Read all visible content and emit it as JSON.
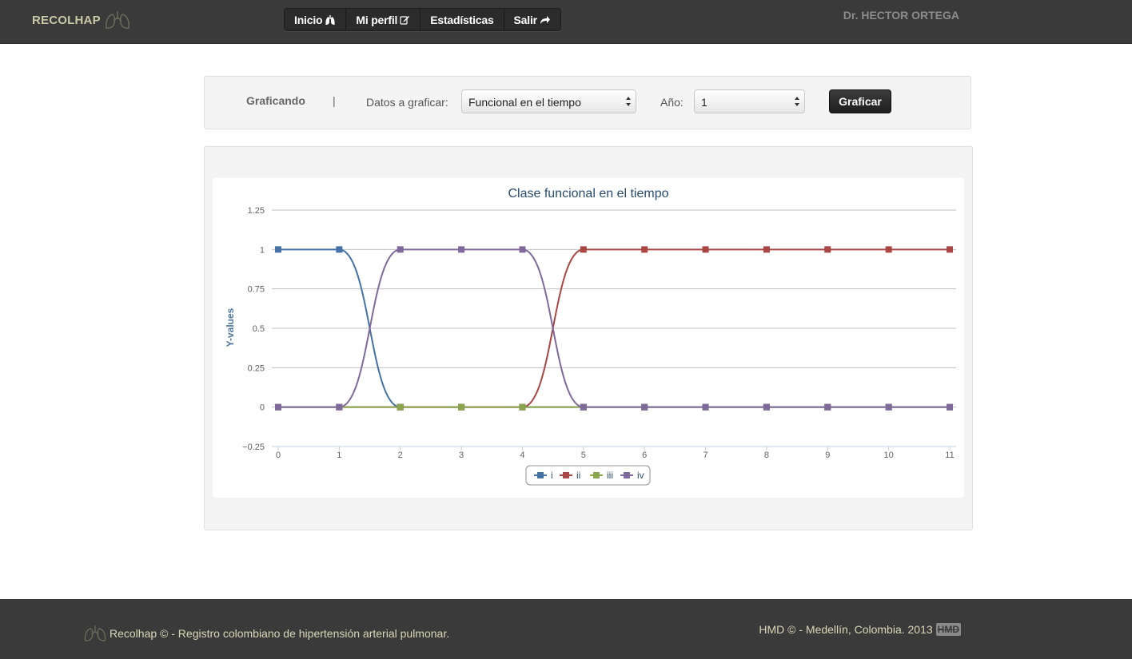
{
  "header": {
    "brand": "RECOLHAP",
    "nav": [
      {
        "label": "Inicio",
        "icon": "lungs-icon"
      },
      {
        "label": "Mi perfil",
        "icon": "edit-icon"
      },
      {
        "label": "Estadísticas",
        "icon": ""
      },
      {
        "label": "Salir",
        "icon": "share-icon"
      }
    ],
    "user": "Dr. HECTOR ORTEGA"
  },
  "filter": {
    "title": "Graficando",
    "separator": "|",
    "data_label": "Datos a graficar:",
    "data_value": "Funcional en el tiempo",
    "year_label": "Año:",
    "year_value": "1",
    "button_label": "Graficar"
  },
  "chart_data": {
    "type": "line",
    "title": "Clase funcional en el tiempo",
    "ylabel": "Y-values",
    "xlabel": "",
    "x": [
      0,
      1,
      2,
      3,
      4,
      5,
      6,
      7,
      8,
      9,
      10,
      11
    ],
    "ylim": [
      -0.25,
      1.25
    ],
    "yticks": [
      1.25,
      1,
      0.75,
      0.5,
      0.25,
      0,
      -0.25
    ],
    "ytick_labels": [
      "1.25",
      "1",
      "0.75",
      "0.5",
      "0.25",
      "0",
      "−0.25"
    ],
    "grid": true,
    "legend": "bottom-center",
    "series": [
      {
        "name": "i",
        "color": "#4572a7",
        "values": [
          1,
          1,
          0,
          0,
          0,
          0,
          0,
          0,
          0,
          0,
          0,
          0
        ]
      },
      {
        "name": "ii",
        "color": "#aa4643",
        "values": [
          0,
          0,
          0,
          0,
          0,
          1,
          1,
          1,
          1,
          1,
          1,
          1
        ]
      },
      {
        "name": "iii",
        "color": "#89a54e",
        "values": [
          0,
          0,
          0,
          0,
          0,
          0,
          0,
          0,
          0,
          0,
          0,
          0
        ]
      },
      {
        "name": "iv",
        "color": "#80699b",
        "values": [
          0,
          0,
          1,
          1,
          1,
          0,
          0,
          0,
          0,
          0,
          0,
          0
        ]
      }
    ]
  },
  "footer": {
    "left": "Recolhap © - Registro colombiano de hipertensión arterial pulmonar.",
    "right": "HMD © - Medellín, Colombia. 2013",
    "badge": "HMD"
  }
}
